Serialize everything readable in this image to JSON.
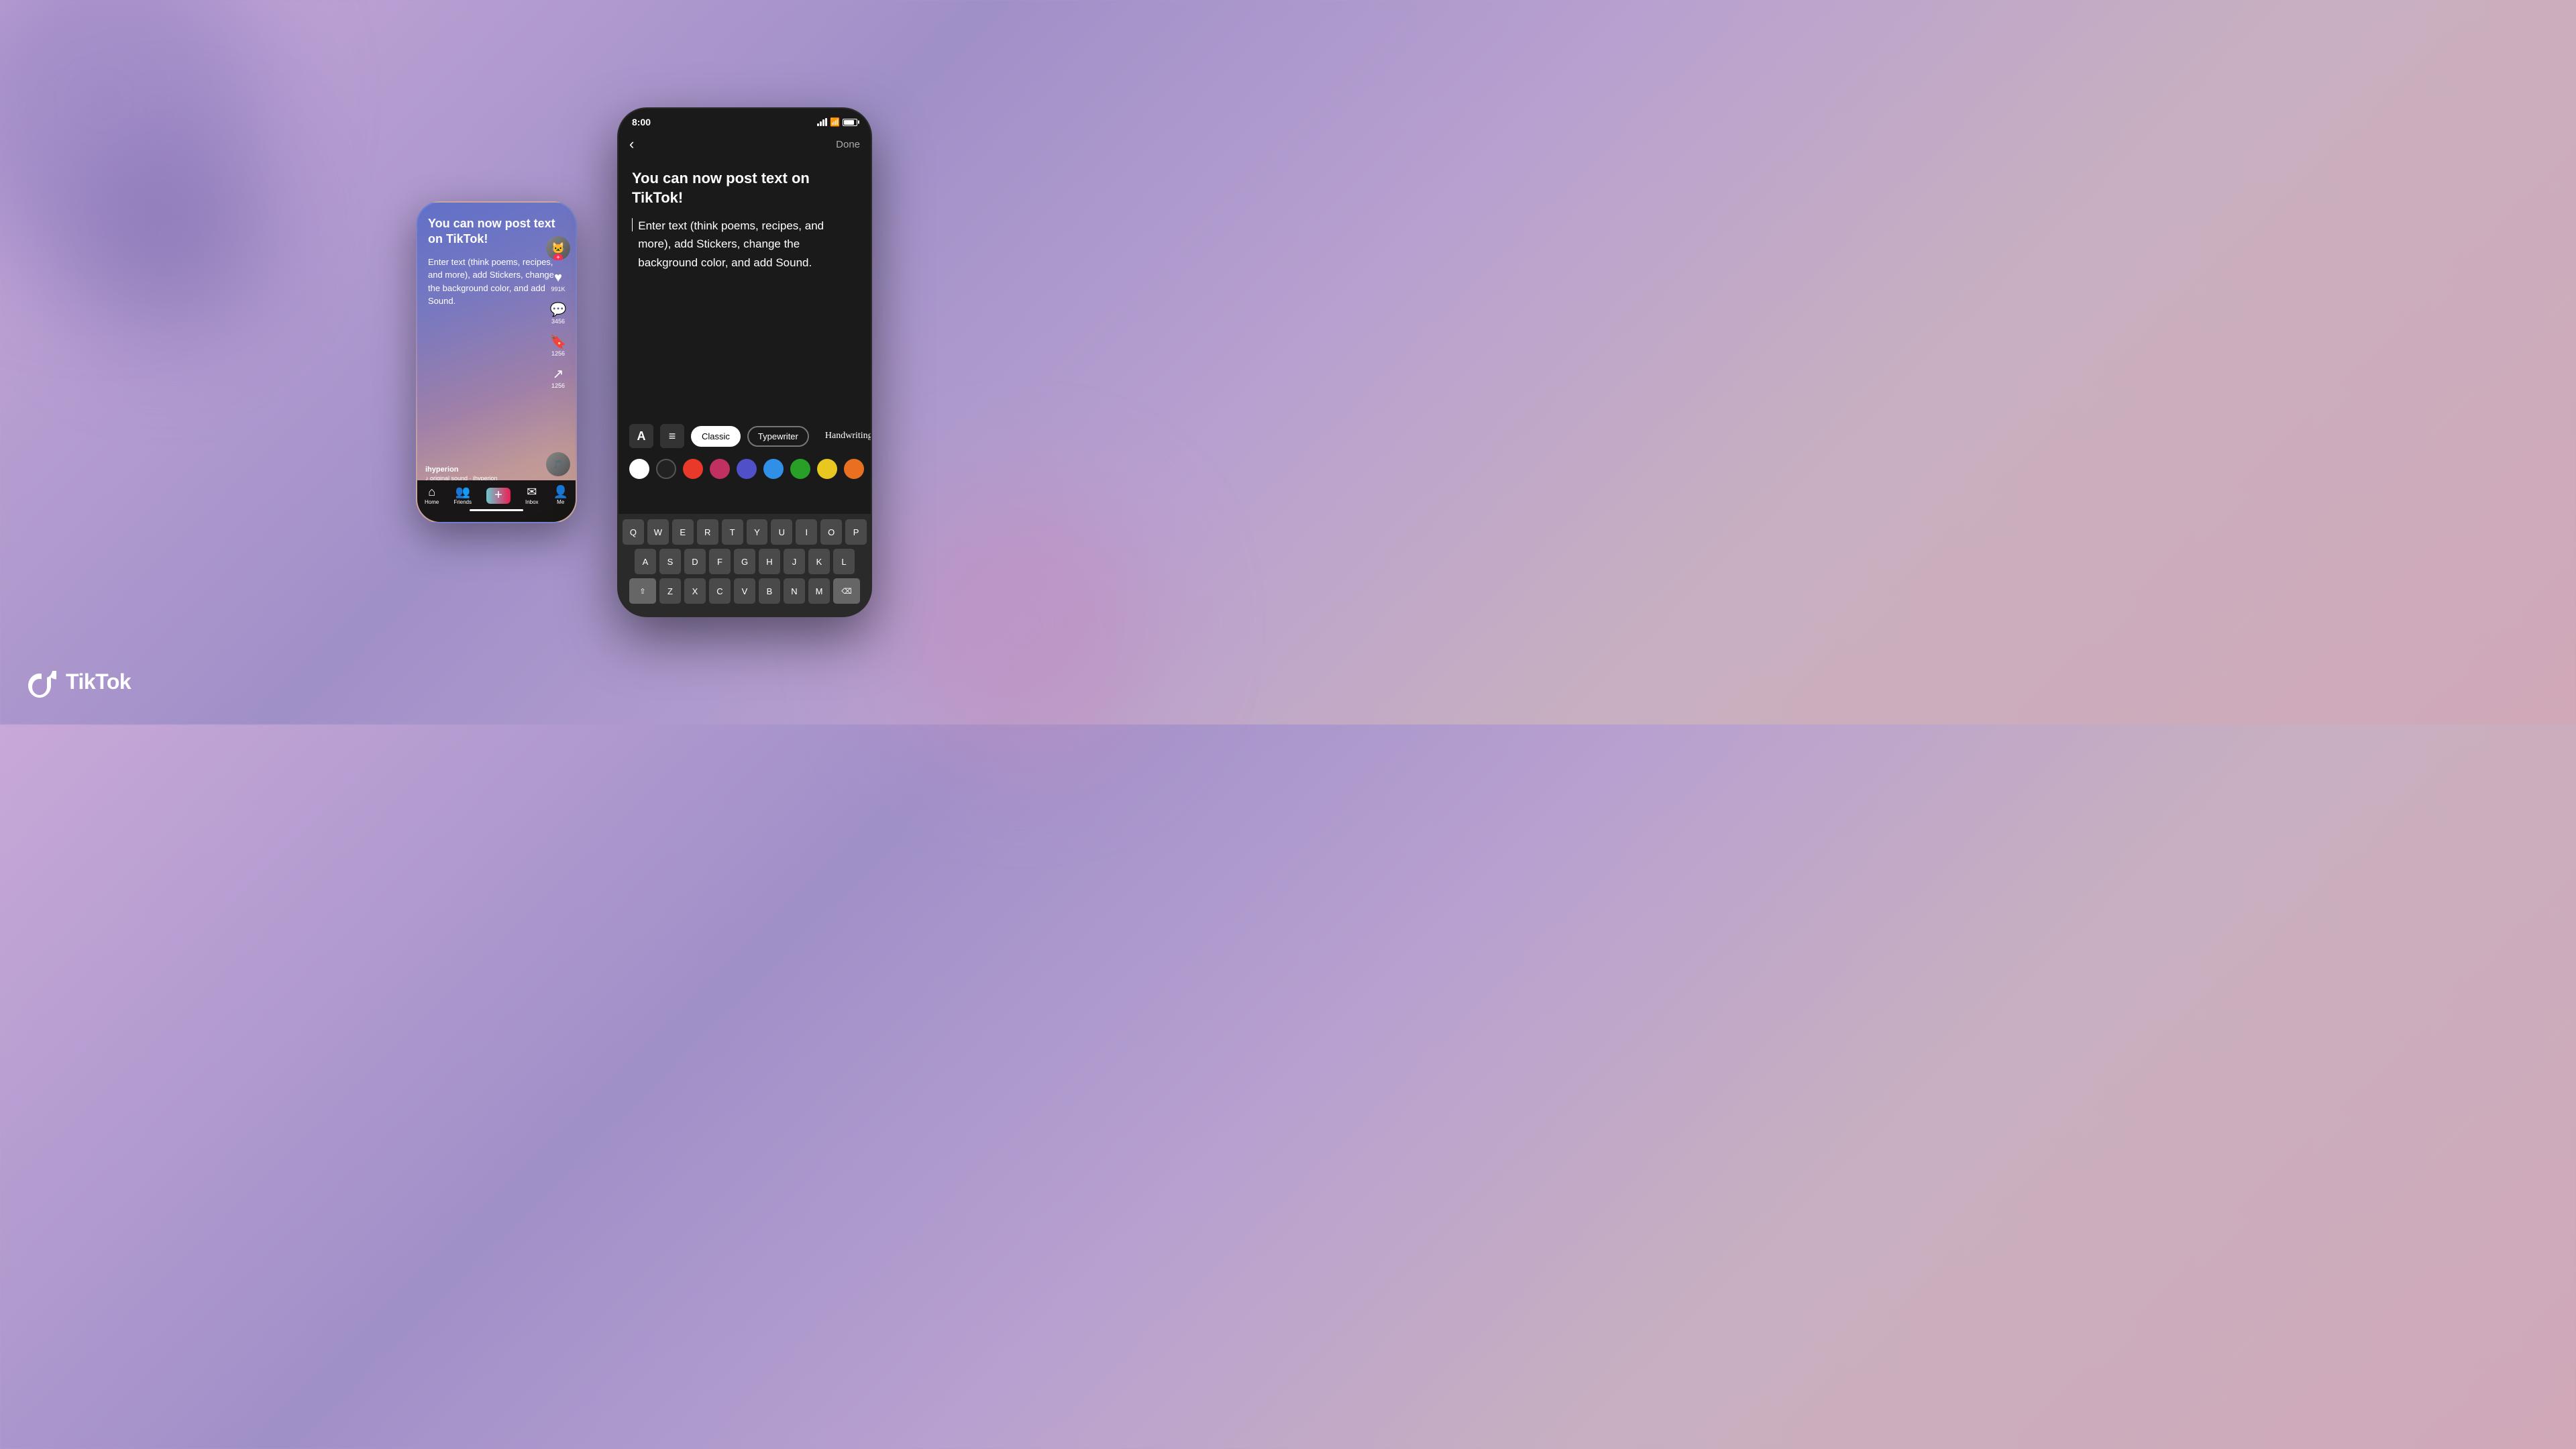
{
  "background": {
    "gradient": "linear-gradient(135deg, #c8a8d8 0%, #a090c8 30%, #b8a0d0 50%, #c8b0c0 70%, #d0a8b8 100%)"
  },
  "logo": {
    "text": "TikTok",
    "icon": "♪"
  },
  "phone_left": {
    "title": "You can now post text on TikTok!",
    "description": "Enter text (think poems, recipes, and more), add Stickers, change the background color, and add Sound.",
    "username": "ihyperion",
    "sound": "♪ original sound · ihyperion",
    "likes": "991K",
    "comments": "3456",
    "bookmarks": "1256",
    "shares": "1256",
    "nav": {
      "home": "Home",
      "friends": "Friends",
      "inbox": "Inbox",
      "me": "Me"
    }
  },
  "phone_right": {
    "status_time": "8:00",
    "done_label": "Done",
    "title": "You can now post text on TikTok!",
    "body": "Enter text (think poems, recipes, and more), add Stickers, change the background color, and add Sound.",
    "toolbar": {
      "font_icon": "A",
      "align_icon": "≡",
      "fonts": [
        "Classic",
        "Typewriter",
        "Handwriting"
      ],
      "font_active": "Classic"
    },
    "colors": [
      "white",
      "black",
      "red",
      "pink",
      "purple",
      "blue",
      "green",
      "yellow",
      "orange",
      "lightpink"
    ],
    "keyboard": {
      "row1": [
        "Q",
        "W",
        "E",
        "R",
        "T",
        "Y",
        "U",
        "I",
        "O",
        "P"
      ],
      "row2": [
        "A",
        "S",
        "D",
        "F",
        "G",
        "H",
        "J",
        "K",
        "L"
      ],
      "row3": [
        "Z",
        "X",
        "C",
        "V",
        "B",
        "N",
        "M"
      ]
    }
  }
}
